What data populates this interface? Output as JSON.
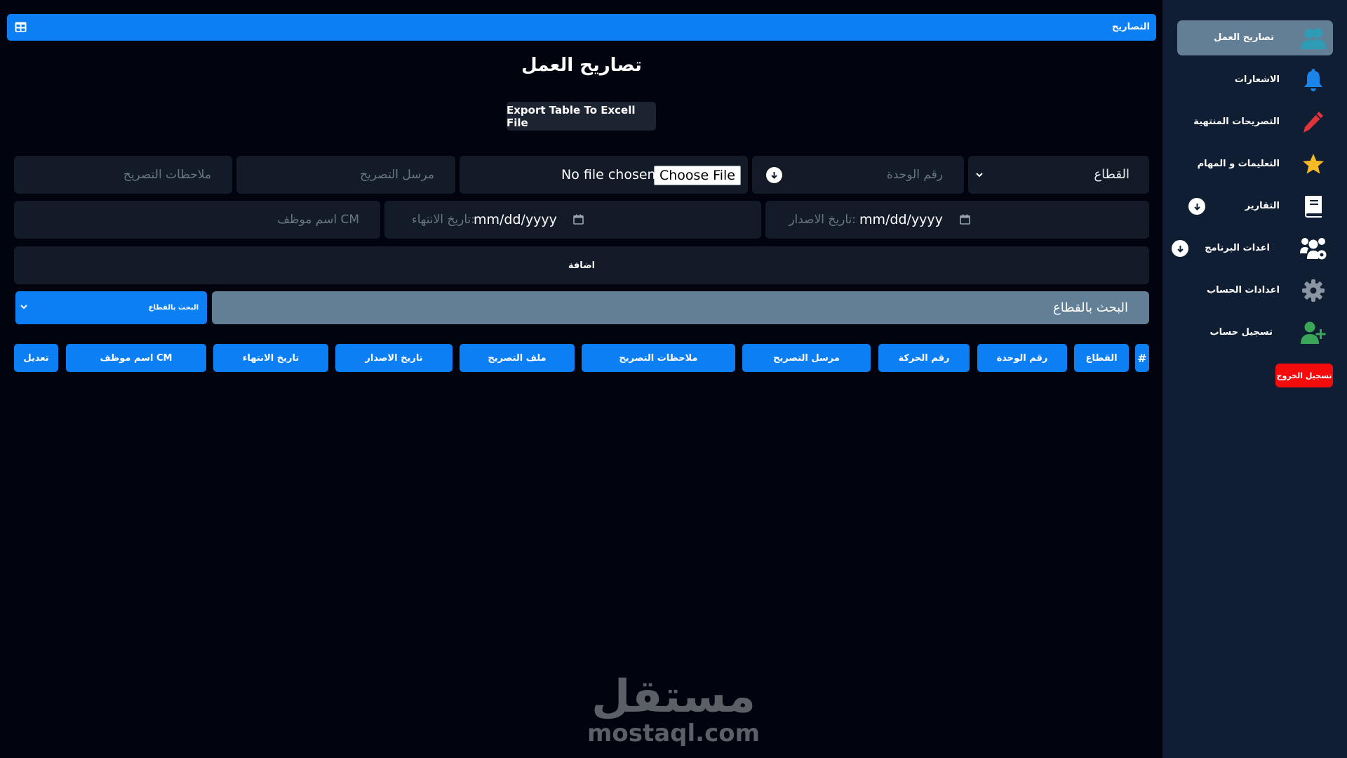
{
  "header": {
    "title": "التصاريح",
    "table_icon": "table-icon"
  },
  "page": {
    "title": "تصاريح العمل",
    "export_label": "Export Table To Excell File"
  },
  "form": {
    "sector_value": "القطاع",
    "unit_number_placeholder": "رقم الوحدة",
    "file_no_chosen": "No file chosen",
    "file_button": "Choose File",
    "sender_placeholder": "مرسل التصريح",
    "notes_placeholder": "ملاحظات التصريح",
    "issue_date_label": "تاريخ الاصدار:",
    "issue_date_value": "mm/dd/yyyy",
    "end_date_label": "تاريخ الانتهاء:",
    "end_date_value": "mm/dd/yyyy",
    "cm_employee_placeholder": "اسم موظف CM",
    "add_label": "اضافة"
  },
  "search": {
    "placeholder": "البحث بالقطاع",
    "select_label": "البحث بالقطاع"
  },
  "table": {
    "columns": [
      "#",
      "القطاع",
      "رقم الوحدة",
      "رقم الحركة",
      "مرسل التصريح",
      "ملاحظات التصريح",
      "ملف التصريح",
      "تاريخ الاصدار",
      "تاريخ الانتهاء",
      "اسم موظف CM",
      "تعديل"
    ]
  },
  "sidebar": {
    "items": [
      {
        "label": "تصاريح العمل",
        "icon": "users-icon",
        "active": true
      },
      {
        "label": "الاشعارات",
        "icon": "bell-icon"
      },
      {
        "label": "التصريحات المنتهية",
        "icon": "pencil-icon"
      },
      {
        "label": "التعليمات و المهام",
        "icon": "star-icon"
      },
      {
        "label": "التقارير",
        "icon": "book-icon",
        "dropdown": true
      },
      {
        "label": "اعدات البرنامج",
        "icon": "users-gear-icon",
        "dropdown": true
      },
      {
        "label": "اعدادات الحساب",
        "icon": "gear-icon"
      },
      {
        "label": "تسجيل حساب",
        "icon": "user-plus-icon"
      }
    ],
    "logout_label": "تسجيل الخروج"
  },
  "watermark": {
    "arabic": "مستقل",
    "latin": "mostaql.com"
  },
  "colors": {
    "accent": "#0d7ff5",
    "background": "#01030f",
    "sidebar": "#0f1e33",
    "field": "#121b27",
    "active_item": "#627f95",
    "logout": "#f40b0b",
    "icon_blue": "#1b84ea",
    "icon_red": "#e0333a",
    "icon_yellow": "#f4b925",
    "icon_green": "#3aa657",
    "icon_gray": "#8b95a1"
  }
}
